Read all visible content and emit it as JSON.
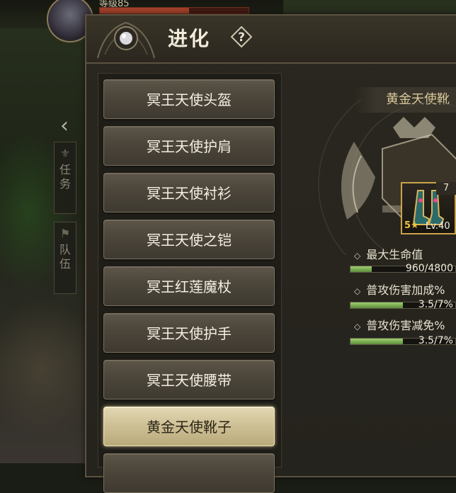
{
  "hud": {
    "level_text": "等级85"
  },
  "side_tabs": [
    {
      "label": "任务"
    },
    {
      "label": "队伍"
    }
  ],
  "panel": {
    "title": "进化",
    "help_icon": "question-icon"
  },
  "items": [
    {
      "label": "冥王天使头盔",
      "selected": false
    },
    {
      "label": "冥王天使护肩",
      "selected": false
    },
    {
      "label": "冥王天使衬衫",
      "selected": false
    },
    {
      "label": "冥王天使之铠",
      "selected": false
    },
    {
      "label": "冥王红莲魔杖",
      "selected": false
    },
    {
      "label": "冥王天使护手",
      "selected": false
    },
    {
      "label": "冥王天使腰带",
      "selected": false
    },
    {
      "label": "黄金天使靴子",
      "selected": true
    }
  ],
  "detail": {
    "name": "黄金天使靴",
    "icon": {
      "count": "7",
      "stars": "5★",
      "level": "Lv.40"
    },
    "stats": [
      {
        "name": "最大生命值",
        "value": "960/4800",
        "progress": 0.2
      },
      {
        "name": "普攻伤害加成%",
        "value": "3.5/7%",
        "progress": 0.5
      },
      {
        "name": "普攻伤害减免%",
        "value": "3.5/7%",
        "progress": 0.5
      }
    ]
  },
  "colors": {
    "panel_bg": "#25231d",
    "button_normal": "#4b453a",
    "button_selected": "#cdbf94",
    "progress_fill": "#7fb04f",
    "gold": "#c9a24a"
  }
}
